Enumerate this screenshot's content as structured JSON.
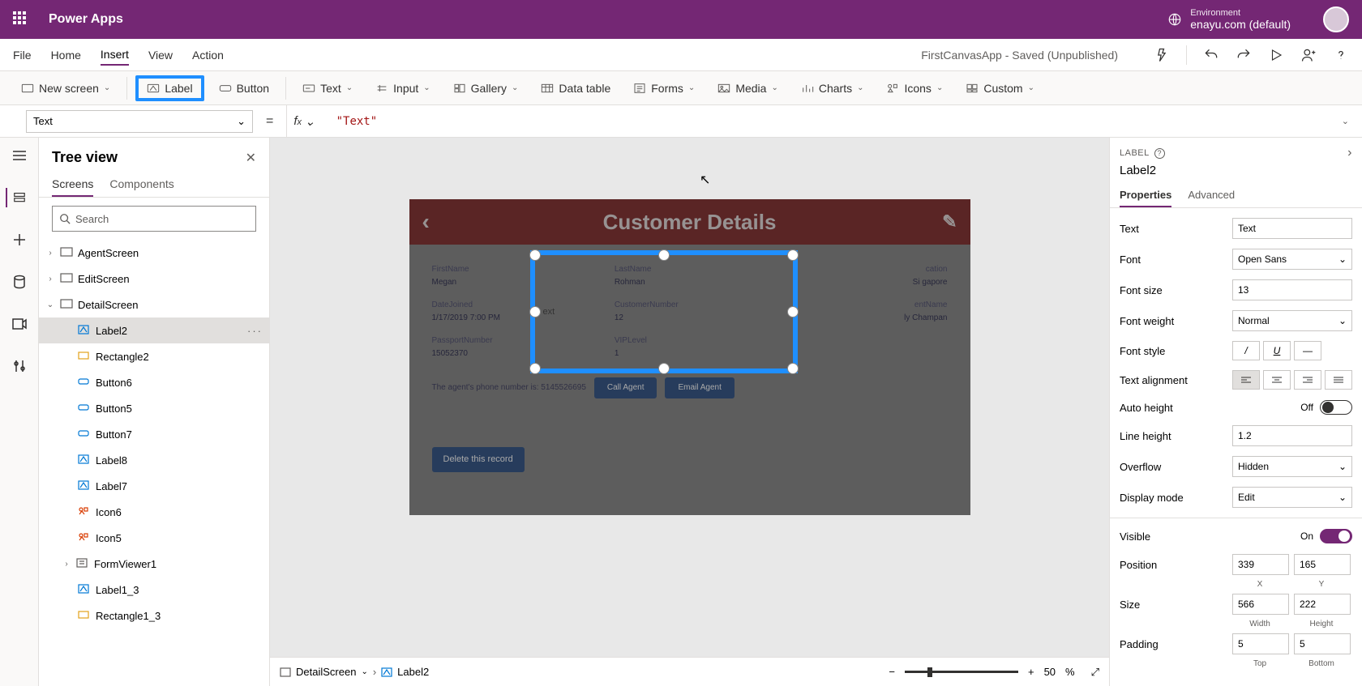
{
  "header": {
    "product": "Power Apps",
    "env_label": "Environment",
    "env_value": "enayu.com (default)"
  },
  "menu": {
    "file": "File",
    "home": "Home",
    "insert": "Insert",
    "view": "View",
    "action": "Action",
    "doc_status": "FirstCanvasApp - Saved (Unpublished)"
  },
  "ribbon": {
    "new_screen": "New screen",
    "label": "Label",
    "button": "Button",
    "text": "Text",
    "input": "Input",
    "gallery": "Gallery",
    "data_table": "Data table",
    "forms": "Forms",
    "media": "Media",
    "charts": "Charts",
    "icons": "Icons",
    "custom": "Custom"
  },
  "formula": {
    "property": "Text",
    "value": "\"Text\""
  },
  "tree": {
    "title": "Tree view",
    "tab_screens": "Screens",
    "tab_components": "Components",
    "search_placeholder": "Search",
    "nodes": {
      "agent": "AgentScreen",
      "edit": "EditScreen",
      "detail": "DetailScreen",
      "label2": "Label2",
      "rectangle2": "Rectangle2",
      "button6": "Button6",
      "button5": "Button5",
      "button7": "Button7",
      "label8": "Label8",
      "label7": "Label7",
      "icon6": "Icon6",
      "icon5": "Icon5",
      "formviewer1": "FormViewer1",
      "label1_3": "Label1_3",
      "rectangle1_3": "Rectangle1_3"
    }
  },
  "canvas": {
    "title": "Customer Details",
    "sel_text": "ext",
    "fields": {
      "firstname_l": "FirstName",
      "firstname_v": "Megan",
      "lastname_l": "LastName",
      "lastname_v": "Rohman",
      "location_l": "cation",
      "location_v": "Si   gapore",
      "datejoined_l": "DateJoined",
      "datejoined_v": "1/17/2019 7:00 PM",
      "custnum_l": "CustomerNumber",
      "custnum_v": "12",
      "agentname_l": "entName",
      "agentname_v": "ly Champan",
      "passport_l": "PassportNumber",
      "passport_v": "15052370",
      "vip_l": "VIPLevel",
      "vip_v": "1"
    },
    "agent_line": "The agent's phone number is:  5145526695",
    "call": "Call Agent",
    "email": "Email Agent",
    "delete": "Delete this record",
    "footer": {
      "screen": "DetailScreen",
      "selected": "Label2",
      "zoom": "50",
      "pct": "%"
    }
  },
  "props": {
    "kind": "LABEL",
    "name": "Label2",
    "tab_props": "Properties",
    "tab_adv": "Advanced",
    "text_l": "Text",
    "text_v": "Text",
    "font_l": "Font",
    "font_v": "Open Sans",
    "fontsize_l": "Font size",
    "fontsize_v": "13",
    "fontweight_l": "Font weight",
    "fontweight_v": "Normal",
    "fontstyle_l": "Font style",
    "align_l": "Text alignment",
    "autoheight_l": "Auto height",
    "autoheight_state": "Off",
    "lineheight_l": "Line height",
    "lineheight_v": "1.2",
    "overflow_l": "Overflow",
    "overflow_v": "Hidden",
    "display_l": "Display mode",
    "display_v": "Edit",
    "visible_l": "Visible",
    "visible_state": "On",
    "position_l": "Position",
    "pos_x": "339",
    "pos_y": "165",
    "pos_xl": "X",
    "pos_yl": "Y",
    "size_l": "Size",
    "size_w": "566",
    "size_h": "222",
    "size_wl": "Width",
    "size_hl": "Height",
    "padding_l": "Padding",
    "pad_t": "5",
    "pad_b": "5",
    "pad_tl": "Top",
    "pad_bl": "Bottom"
  }
}
